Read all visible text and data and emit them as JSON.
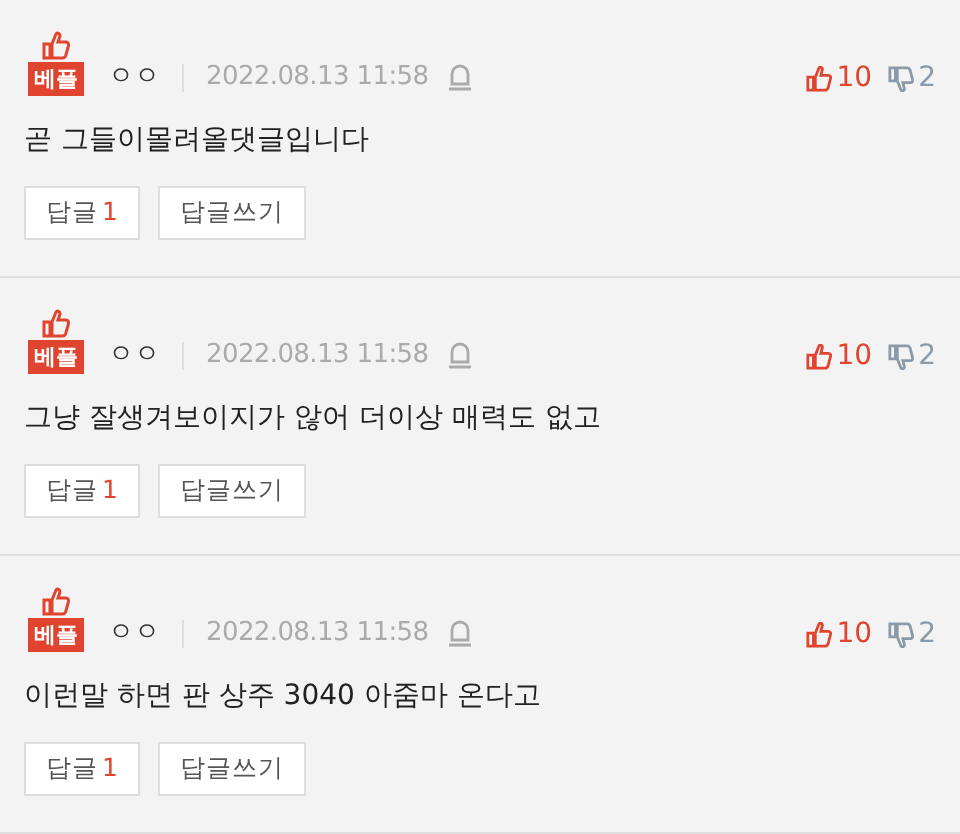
{
  "comments": [
    {
      "badge": "베플",
      "nickname": "ㅇㅇ",
      "date": "2022.08.13 11:58",
      "likes": "10",
      "dislikes": "2",
      "text": "곧 그들이몰려올댓글입니다",
      "reply_label": "답글",
      "reply_count": "1",
      "write_reply": "답글쓰기"
    },
    {
      "badge": "베플",
      "nickname": "ㅇㅇ",
      "date": "2022.08.13 11:58",
      "likes": "10",
      "dislikes": "2",
      "text": "그냥 잘생겨보이지가 않어 더이상 매력도 없고",
      "reply_label": "답글",
      "reply_count": "1",
      "write_reply": "답글쓰기"
    },
    {
      "badge": "베플",
      "nickname": "ㅇㅇ",
      "date": "2022.08.13 11:58",
      "likes": "10",
      "dislikes": "2",
      "text": "이런말 하면 판 상주 3040 아줌마 온다고",
      "reply_label": "답글",
      "reply_count": "1",
      "write_reply": "답글쓰기"
    }
  ]
}
